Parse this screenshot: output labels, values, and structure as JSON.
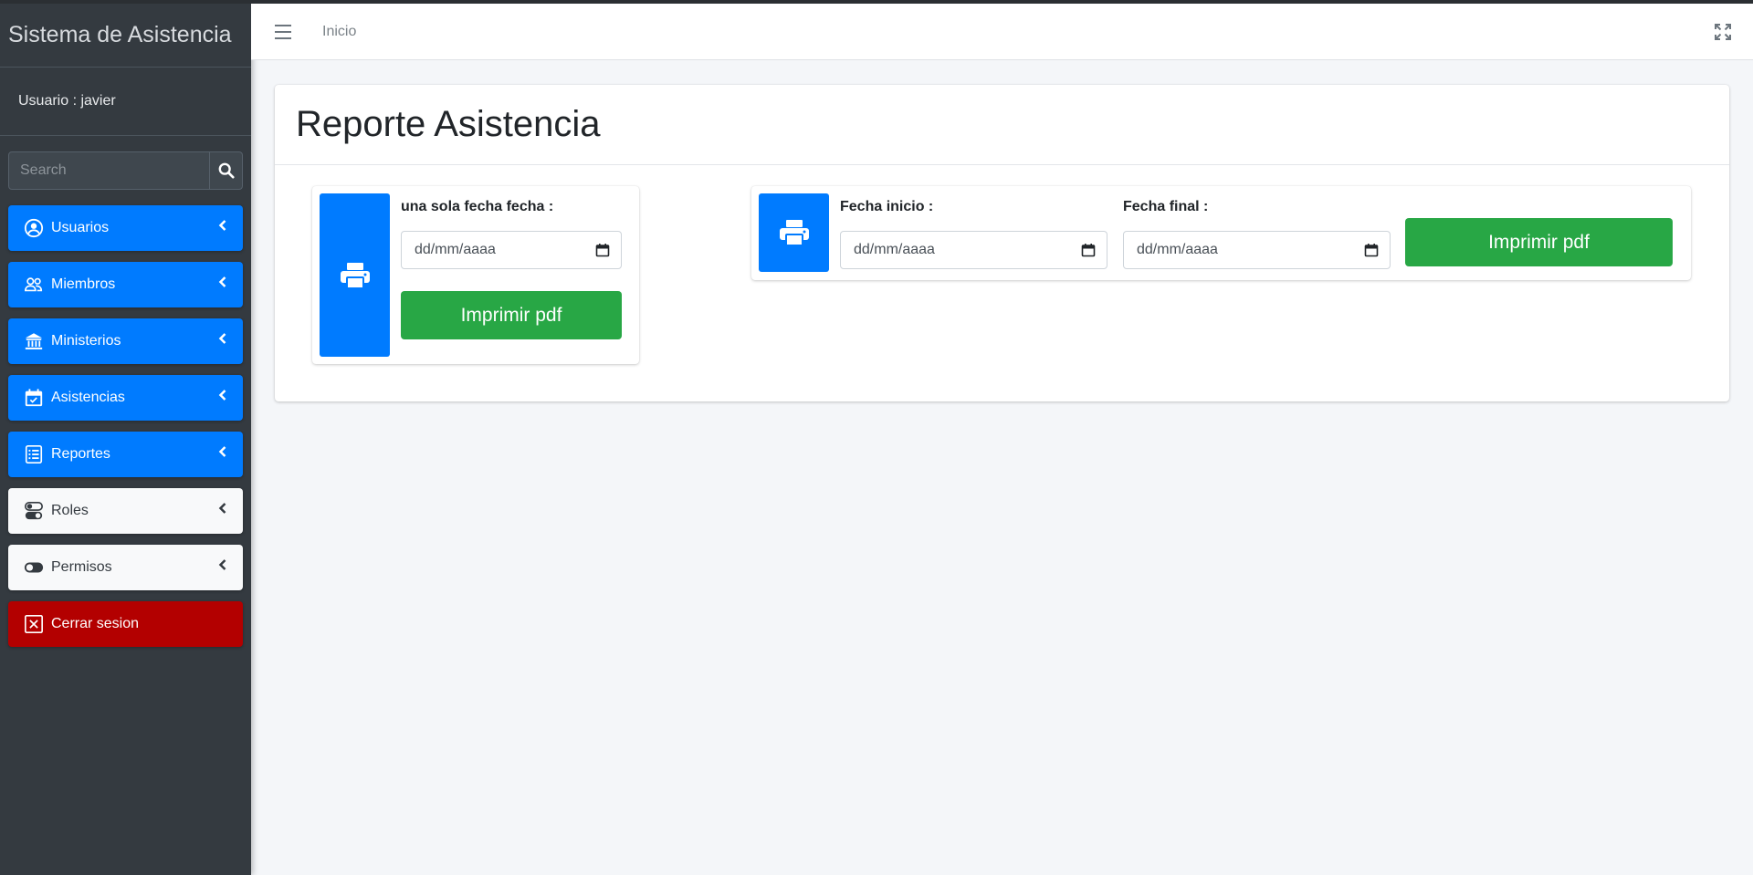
{
  "app": {
    "title": "Sistema de Asistencia"
  },
  "user": {
    "label": "Usuario : javier"
  },
  "search": {
    "placeholder": "Search"
  },
  "sidebar": {
    "items": [
      {
        "label": "Usuarios",
        "icon": "user-circle-icon"
      },
      {
        "label": "Miembros",
        "icon": "users-icon"
      },
      {
        "label": "Ministerios",
        "icon": "institution-icon"
      },
      {
        "label": "Asistencias",
        "icon": "calendar-check-icon"
      },
      {
        "label": "Reportes",
        "icon": "report-list-icon"
      },
      {
        "label": "Roles",
        "icon": "toggles-icon"
      },
      {
        "label": "Permisos",
        "icon": "toggle-icon"
      },
      {
        "label": "Cerrar sesion",
        "icon": "close-square-icon"
      }
    ]
  },
  "header": {
    "home_link": "Inicio"
  },
  "main": {
    "title": "Reporte Asistencia",
    "single": {
      "label": "una sola fecha fecha :",
      "date_placeholder": "dd/mm/aaaa",
      "button": "Imprimir pdf"
    },
    "range": {
      "start_label": "Fecha inicio :",
      "end_label": "Fecha final :",
      "start_placeholder": "dd/mm/aaaa",
      "end_placeholder": "dd/mm/aaaa",
      "button": "Imprimir pdf"
    }
  },
  "colors": {
    "primary": "#007bff",
    "success": "#28a745",
    "danger": "#b30000",
    "sidebar": "#343a40"
  }
}
